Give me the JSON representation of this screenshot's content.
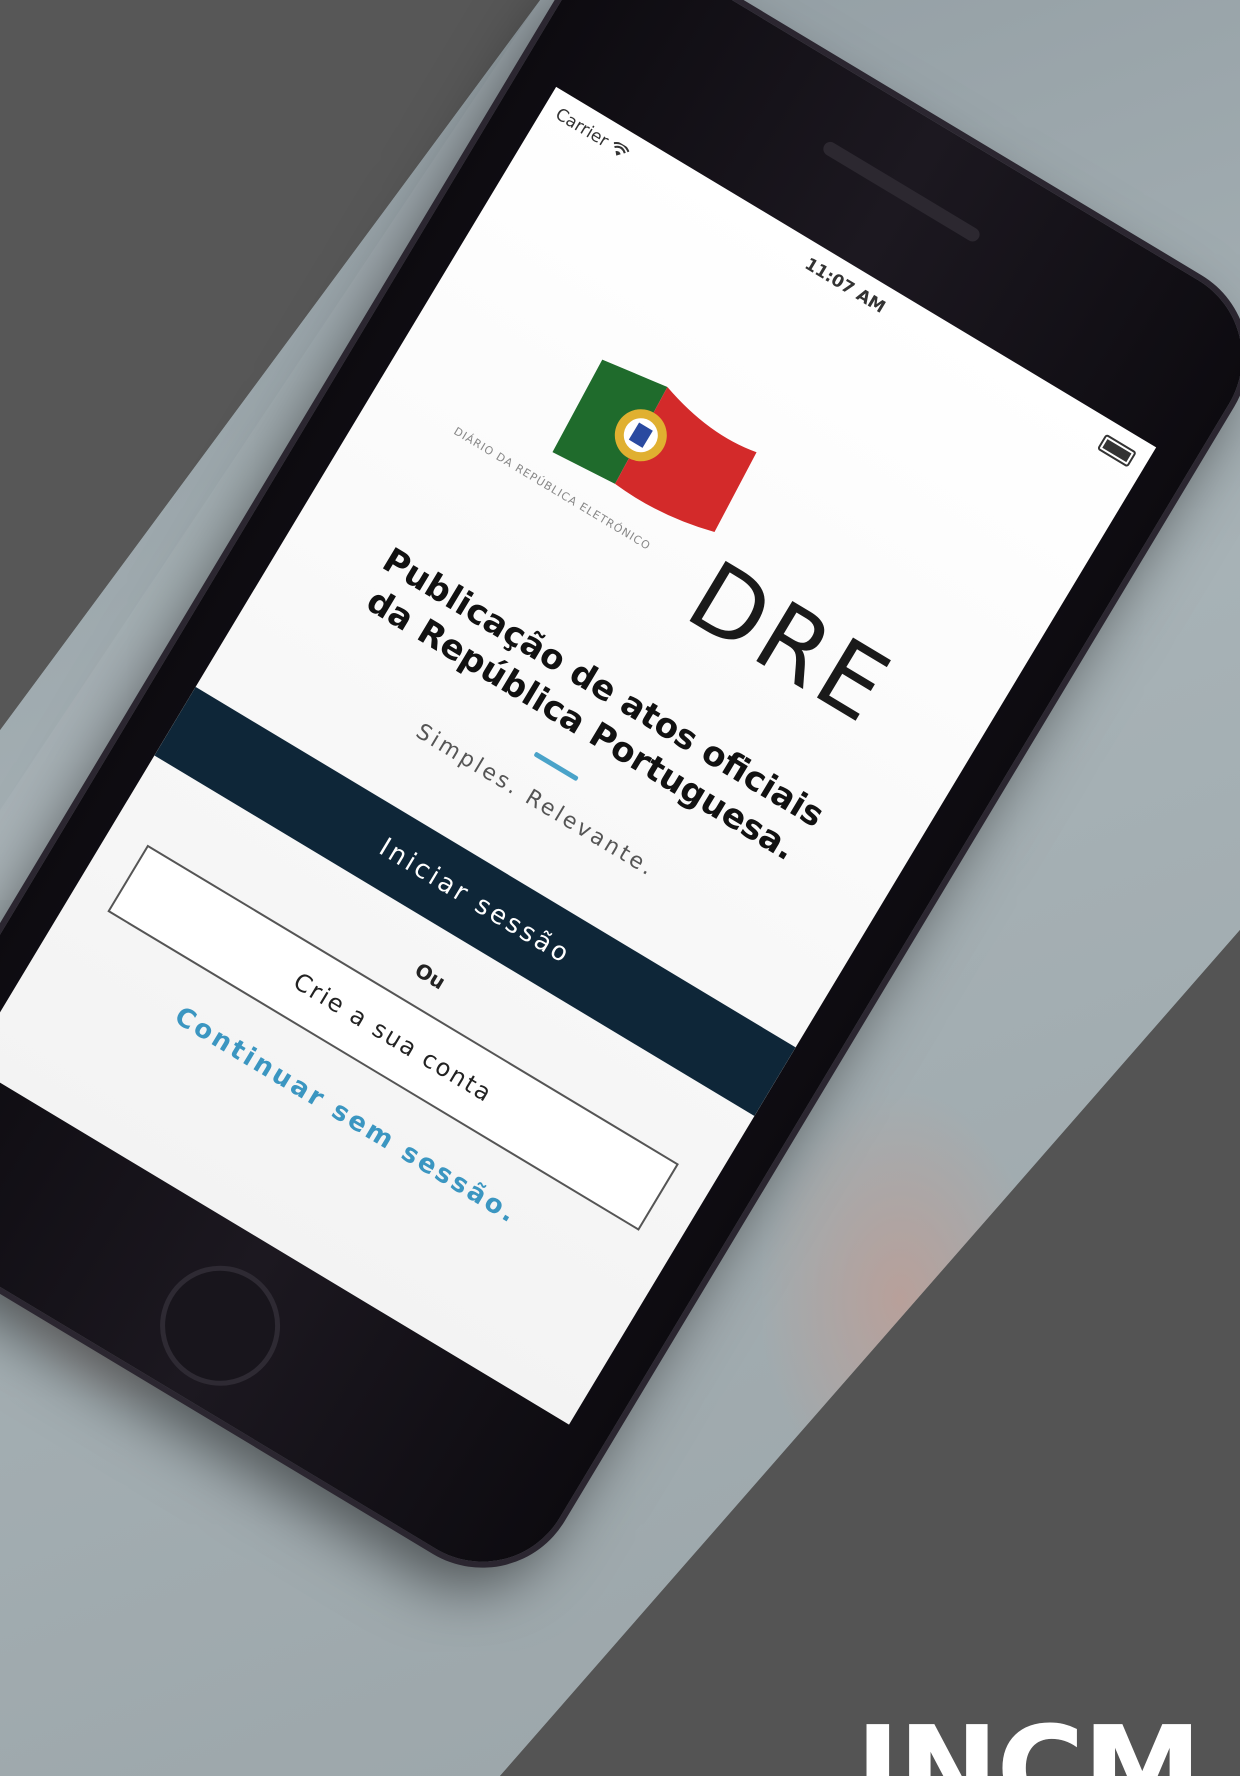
{
  "status_bar": {
    "carrier": "Carrier",
    "time": "11:07 AM"
  },
  "logo": {
    "subtitle": "Diário da República Eletrónico",
    "name": "DRE",
    "flag_colors": {
      "green": "#1f6b2c",
      "red": "#d32a2a",
      "gold": "#e0b030"
    }
  },
  "headline": {
    "line1": "Publicação de atos oficiais",
    "line2": "da República Portuguesa."
  },
  "tagline": "Simples. Relevante.",
  "actions": {
    "login_label": "Iniciar sessão",
    "or_label": "Ou",
    "create_account_label": "Crie a sua conta",
    "continue_label": "Continuar sem sessão."
  },
  "brand": {
    "mark": "INCM"
  },
  "colors": {
    "primary_button": "#0e2638",
    "link": "#3b96c1",
    "accent": "#4aa3c9",
    "background_dark": "#545454"
  }
}
